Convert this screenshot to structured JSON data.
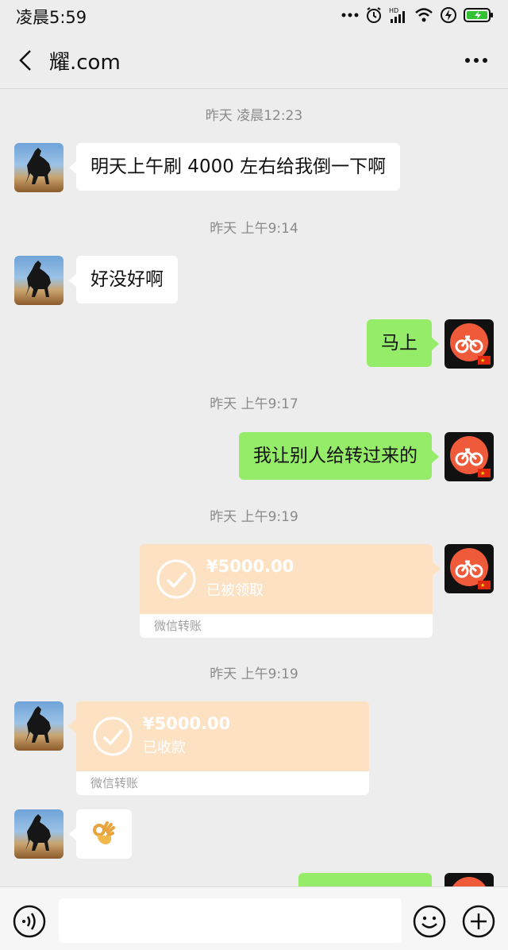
{
  "status_bar": {
    "time": "凌晨5:59",
    "icons": [
      "more-dots-icon",
      "alarm-icon",
      "hd-signal-icon",
      "wifi-icon",
      "charging-icon",
      "battery-icon"
    ]
  },
  "header": {
    "title": "耀.com",
    "back_icon": "chevron-left-icon",
    "more_icon": "more-dots-icon"
  },
  "messages": [
    {
      "type": "timestamp",
      "text": "昨天 凌晨12:23"
    },
    {
      "type": "text",
      "from": "them",
      "text": "明天上午刷 4000 左右给我倒一下啊"
    },
    {
      "type": "timestamp",
      "text": "昨天 上午9:14"
    },
    {
      "type": "text",
      "from": "them",
      "text": "好没好啊"
    },
    {
      "type": "text",
      "from": "me",
      "text": "马上"
    },
    {
      "type": "timestamp",
      "text": "昨天 上午9:17"
    },
    {
      "type": "text",
      "from": "me",
      "text": "我让别人给转过来的"
    },
    {
      "type": "timestamp",
      "text": "昨天 上午9:19"
    },
    {
      "type": "transfer",
      "from": "me",
      "amount": "¥5000.00",
      "status": "已被领取",
      "footer": "微信转账"
    },
    {
      "type": "timestamp",
      "text": "昨天 上午9:19"
    },
    {
      "type": "transfer",
      "from": "them",
      "amount": "¥5000.00",
      "status": "已收款",
      "footer": "微信转账"
    },
    {
      "type": "emoji",
      "from": "them",
      "emoji": "👌"
    },
    {
      "type": "text",
      "from": "me",
      "text": ""
    }
  ],
  "input_bar": {
    "voice_icon": "voice-icon",
    "input_value": "",
    "emoji_icon": "smile-icon",
    "plus_icon": "plus-icon"
  },
  "colors": {
    "background": "#ededed",
    "outgoing_bubble": "#95ec69",
    "incoming_bubble": "#ffffff",
    "transfer_card": "#fde1c3",
    "timestamp": "#8a8a8a"
  }
}
